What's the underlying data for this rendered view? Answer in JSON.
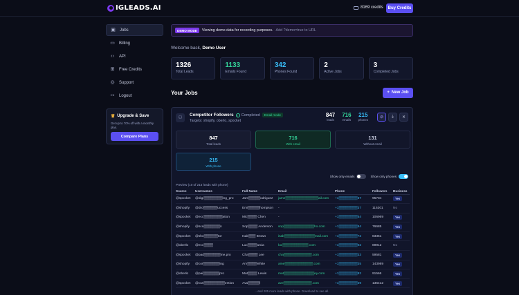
{
  "app": {
    "logo": "IGLEADS.AI",
    "credits": "8169 credits",
    "buy_label": "Buy Credits"
  },
  "sidebar": {
    "items": [
      {
        "label": "Jobs",
        "icon": "briefcase-icon"
      },
      {
        "label": "Billing",
        "icon": "card-icon"
      },
      {
        "label": "API",
        "icon": "code-icon"
      },
      {
        "label": "Free Credits",
        "icon": "gift-icon"
      },
      {
        "label": "Support",
        "icon": "support-icon"
      },
      {
        "label": "Logout",
        "icon": "logout-icon"
      }
    ],
    "upgrade": {
      "title": "Upgrade & Save",
      "subtitle": "Get up to 70% off with a monthly plan.",
      "button": "Compare Plans"
    }
  },
  "banner": {
    "badge": "DEMO MODE",
    "text": "Viewing demo data for recording purposes.",
    "hint": "Add ?demo=true to URL"
  },
  "welcome": {
    "prefix": "Welcome back,",
    "name": "Demo User"
  },
  "stats": [
    {
      "value": "1326",
      "label": "Total Leads",
      "color": "#ffffff"
    },
    {
      "value": "1133",
      "label": "Emails Found",
      "color": "#34d399"
    },
    {
      "value": "342",
      "label": "Phones Found",
      "color": "#38bdf8"
    },
    {
      "value": "2",
      "label": "Active Jobs",
      "color": "#ffffff"
    },
    {
      "value": "3",
      "label": "Completed Jobs",
      "color": "#ffffff"
    }
  ],
  "jobs": {
    "title": "Your Jobs",
    "new_label": "New Job"
  },
  "job": {
    "name": "Competitor Followers",
    "status": "Completed",
    "mode": "Email mode",
    "targets": "Targets: shopify, oberlo, spocket",
    "counts": [
      {
        "value": "847",
        "label": "leads"
      },
      {
        "value": "716",
        "label": "emails"
      },
      {
        "value": "215",
        "label": "phones"
      }
    ],
    "filters": [
      {
        "value": "847",
        "label": "Total leads"
      },
      {
        "value": "716",
        "label": "With email"
      },
      {
        "value": "131",
        "label": "Without email"
      },
      {
        "value": "215",
        "label": "With phone"
      }
    ],
    "toggles": {
      "emails": "Show only emails",
      "phones": "Show only phones"
    },
    "preview": "Preview (10 of 215 leads with phone)",
    "columns": [
      "Source",
      "Usernames",
      "Full Name",
      "Email",
      "Phone",
      "Followers",
      "Business"
    ],
    "rows": [
      {
        "source": "@spocket",
        "username": "@digi▒▒▒▒▒▒▒▒ing_pro",
        "name": "Jam▒▒▒▒▒odriguez",
        "email": "jame▒▒▒▒▒▒▒▒▒▒▒▒▒▒ail.com",
        "phone": "+1▒▒▒▒▒▒▒▒37",
        "followers": "95704",
        "business": "Yes"
      },
      {
        "source": "@shopify",
        "username": "@dro▒▒▒▒▒▒uccess",
        "name": "Emi▒▒▒▒▒hompson",
        "email": "-",
        "phone": "+1▒▒▒▒▒▒▒▒37",
        "followers": "115301",
        "business": "No"
      },
      {
        "source": "@spocket",
        "username": "@ecc▒▒▒▒▒▒▒▒ation",
        "name": "Mic▒▒▒▒ Chen",
        "email": "-",
        "phone": "+1▒▒▒▒▒▒▒▒54",
        "followers": "106969",
        "business": "Yes"
      },
      {
        "source": "@shopify",
        "username": "@sca▒▒▒▒▒▒▒s",
        "name": "Sop▒▒▒▒ Anderson",
        "email": "sop▒▒▒▒▒▒▒▒▒▒▒▒▒ho.com",
        "phone": "+1▒▒▒▒▒▒▒▒54",
        "followers": "76685",
        "business": "Yes"
      },
      {
        "source": "@spocket",
        "username": "@sho▒▒▒▒▒▒tor",
        "name": "Isab▒▒▒ Brown",
        "email": "isab▒▒▒▒▒▒▒▒▒▒▒▒▒mail.com",
        "phone": "+1▒▒▒▒▒▒▒▒72",
        "followers": "83351",
        "business": "Yes"
      },
      {
        "source": "@oberlo",
        "username": "@ecc▒▒▒▒",
        "name": "Luc▒▒▒▒arcia",
        "email": "luc▒▒▒▒▒▒▒▒▒▒▒.com",
        "phone": "+1▒▒▒▒▒▒▒▒02",
        "followers": "89912",
        "business": "No"
      },
      {
        "source": "@spocket",
        "username": "@pad▒▒▒▒▒▒▒me.pro",
        "name": "Cha▒▒▒▒ Lee",
        "email": "cha▒▒▒▒▒▒▒▒▒▒▒▒.com",
        "phone": "+1▒▒▒▒▒▒▒▒33",
        "followers": "59581",
        "business": "Yes"
      },
      {
        "source": "@shopify",
        "username": "@cor▒▒▒▒▒▒▒ing",
        "name": "Am▒▒▒▒White",
        "email": "ame▒▒▒▒▒▒▒▒▒▒▒▒.com",
        "phone": "+1▒▒▒▒▒▒▒▒35",
        "followers": "143989",
        "business": "Yes"
      },
      {
        "source": "@oberlo",
        "username": "@pai▒▒▒▒▒▒▒pro",
        "name": "Mat▒▒▒▒ Lewis",
        "email": "mat▒▒▒▒▒▒▒▒▒▒▒▒▒ey.com",
        "phone": "+1▒▒▒▒▒▒▒▒82",
        "followers": "91566",
        "business": "Yes"
      },
      {
        "source": "@spocket",
        "username": "@cus▒▒▒▒▒▒▒▒▒ention",
        "name": "Ava▒▒▒▒▒l",
        "email": "ave▒▒▒▒▒▒▒▒▒▒▒▒.com",
        "phone": "+1▒▒▒▒▒▒▒▒29",
        "followers": "136412",
        "business": "Yes"
      }
    ],
    "footnote": "...and 205 more leads with phone. Download to see all."
  }
}
